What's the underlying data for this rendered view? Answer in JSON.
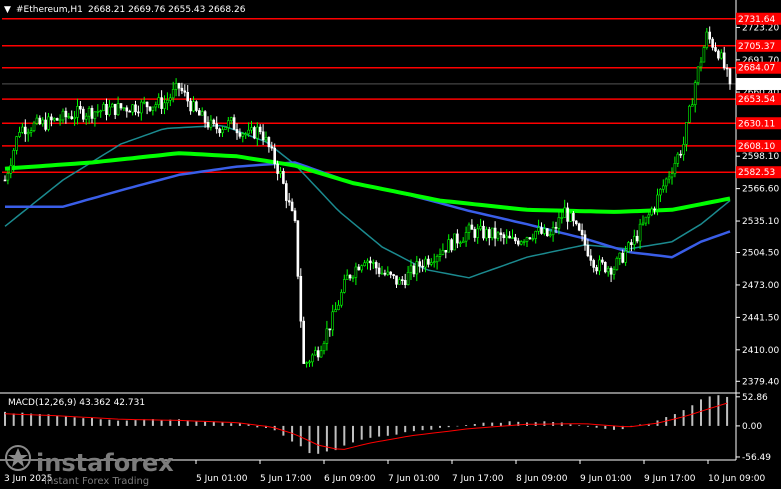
{
  "header": {
    "symbol": "#Ethereum,H1",
    "ohlc": "2668.21 2669.76 2655.43 2668.26"
  },
  "macd_label": "MACD(12,26,9) 43.362 42.731",
  "watermark": {
    "brand": "instaforex",
    "tagline": "Instant Forex Trading"
  },
  "colors": {
    "background": "#000000",
    "bull": "#00ff00",
    "bear": "#ffffff",
    "ma_fast": "#1b8a8f",
    "ma_mid": "#3a5ee8",
    "ma_slow": "#00ff00",
    "level": "#ff0000",
    "macd_hist": "#c0c0c0",
    "macd_signal": "#ff0000"
  },
  "chart_data": {
    "type": "candlestick",
    "ylim": [
      2369,
      2745
    ],
    "yticks": [
      "2723.20",
      "2691.70",
      "2660.40",
      "2629.10",
      "2598.10",
      "2566.60",
      "2535.10",
      "2504.50",
      "2473.00",
      "2441.50",
      "2410.00",
      "2379.40"
    ],
    "current_price": {
      "value": 2668.26,
      "label": "2668.26"
    },
    "levels": [
      {
        "value": 2731.64,
        "label": "2731.64"
      },
      {
        "value": 2705.37,
        "label": "2705.37"
      },
      {
        "value": 2684.07,
        "label": "2684.07"
      },
      {
        "value": 2653.54,
        "label": "2653.54"
      },
      {
        "value": 2630.11,
        "label": "2630.11"
      },
      {
        "value": 2608.1,
        "label": "2608.10"
      },
      {
        "value": 2582.53,
        "label": "2582.53"
      }
    ],
    "xticks": [
      "5 Jun 01:00",
      "5 Jun 17:00",
      "6 Jun 09:00",
      "7 Jun 01:00",
      "7 Jun 17:00",
      "8 Jun 09:00",
      "9 Jun 01:00",
      "9 Jun 17:00",
      "10 Jun 09:00"
    ],
    "first_xtick": "3 Jun 2025",
    "keypoints": [
      [
        0,
        2575
      ],
      [
        5,
        2625
      ],
      [
        14,
        2630
      ],
      [
        25,
        2640
      ],
      [
        40,
        2645
      ],
      [
        55,
        2650
      ],
      [
        60,
        2665
      ],
      [
        66,
        2640
      ],
      [
        72,
        2625
      ],
      [
        78,
        2630
      ],
      [
        84,
        2618
      ],
      [
        88,
        2625
      ],
      [
        91,
        2606
      ],
      [
        95,
        2580
      ],
      [
        100,
        2530
      ],
      [
        103,
        2395
      ],
      [
        108,
        2410
      ],
      [
        113,
        2440
      ],
      [
        118,
        2480
      ],
      [
        124,
        2500
      ],
      [
        130,
        2485
      ],
      [
        136,
        2475
      ],
      [
        144,
        2495
      ],
      [
        152,
        2510
      ],
      [
        160,
        2525
      ],
      [
        168,
        2522
      ],
      [
        175,
        2515
      ],
      [
        183,
        2525
      ],
      [
        188,
        2520
      ],
      [
        193,
        2545
      ],
      [
        198,
        2522
      ],
      [
        204,
        2492
      ],
      [
        210,
        2490
      ],
      [
        216,
        2512
      ],
      [
        222,
        2540
      ],
      [
        228,
        2575
      ],
      [
        234,
        2610
      ],
      [
        238,
        2670
      ],
      [
        242,
        2715
      ],
      [
        246,
        2700
      ],
      [
        250,
        2668.26
      ]
    ],
    "ma_fast_keypoints": [
      [
        0,
        2530
      ],
      [
        20,
        2575
      ],
      [
        40,
        2610
      ],
      [
        55,
        2625
      ],
      [
        75,
        2628
      ],
      [
        90,
        2612
      ],
      [
        100,
        2590
      ],
      [
        115,
        2545
      ],
      [
        130,
        2510
      ],
      [
        145,
        2488
      ],
      [
        160,
        2480
      ],
      [
        180,
        2500
      ],
      [
        200,
        2512
      ],
      [
        215,
        2508
      ],
      [
        230,
        2515
      ],
      [
        240,
        2532
      ],
      [
        250,
        2555
      ]
    ],
    "ma_mid_keypoints": [
      [
        0,
        2549
      ],
      [
        20,
        2549
      ],
      [
        40,
        2565
      ],
      [
        60,
        2580
      ],
      [
        80,
        2588
      ],
      [
        100,
        2592
      ],
      [
        120,
        2572
      ],
      [
        140,
        2560
      ],
      [
        160,
        2545
      ],
      [
        180,
        2532
      ],
      [
        200,
        2518
      ],
      [
        215,
        2505
      ],
      [
        230,
        2500
      ],
      [
        240,
        2515
      ],
      [
        250,
        2525
      ]
    ],
    "ma_slow_keypoints": [
      [
        0,
        2586
      ],
      [
        30,
        2592
      ],
      [
        60,
        2601
      ],
      [
        80,
        2598
      ],
      [
        100,
        2589
      ],
      [
        120,
        2572
      ],
      [
        150,
        2555
      ],
      [
        180,
        2546
      ],
      [
        210,
        2544
      ],
      [
        230,
        2546
      ],
      [
        250,
        2557
      ]
    ],
    "macd": {
      "ylim": [
        -62,
        58
      ],
      "yticks": [
        "52.86",
        "0.00",
        "-56.49"
      ],
      "hist_keypoints": [
        [
          0,
          25
        ],
        [
          20,
          18
        ],
        [
          40,
          10
        ],
        [
          60,
          12
        ],
        [
          80,
          5
        ],
        [
          92,
          -6
        ],
        [
          100,
          -30
        ],
        [
          106,
          -52
        ],
        [
          113,
          -45
        ],
        [
          120,
          -30
        ],
        [
          130,
          -18
        ],
        [
          145,
          -8
        ],
        [
          160,
          3
        ],
        [
          175,
          8
        ],
        [
          190,
          7
        ],
        [
          200,
          -2
        ],
        [
          210,
          -8
        ],
        [
          220,
          2
        ],
        [
          230,
          18
        ],
        [
          240,
          48
        ],
        [
          245,
          56
        ],
        [
          250,
          53
        ]
      ],
      "signal_keypoints": [
        [
          0,
          22
        ],
        [
          20,
          18
        ],
        [
          40,
          12
        ],
        [
          60,
          10
        ],
        [
          80,
          6
        ],
        [
          92,
          -2
        ],
        [
          100,
          -15
        ],
        [
          108,
          -35
        ],
        [
          116,
          -44
        ],
        [
          125,
          -32
        ],
        [
          140,
          -18
        ],
        [
          160,
          -5
        ],
        [
          180,
          3
        ],
        [
          200,
          4
        ],
        [
          215,
          -2
        ],
        [
          225,
          5
        ],
        [
          235,
          18
        ],
        [
          245,
          35
        ],
        [
          250,
          43
        ]
      ]
    }
  }
}
